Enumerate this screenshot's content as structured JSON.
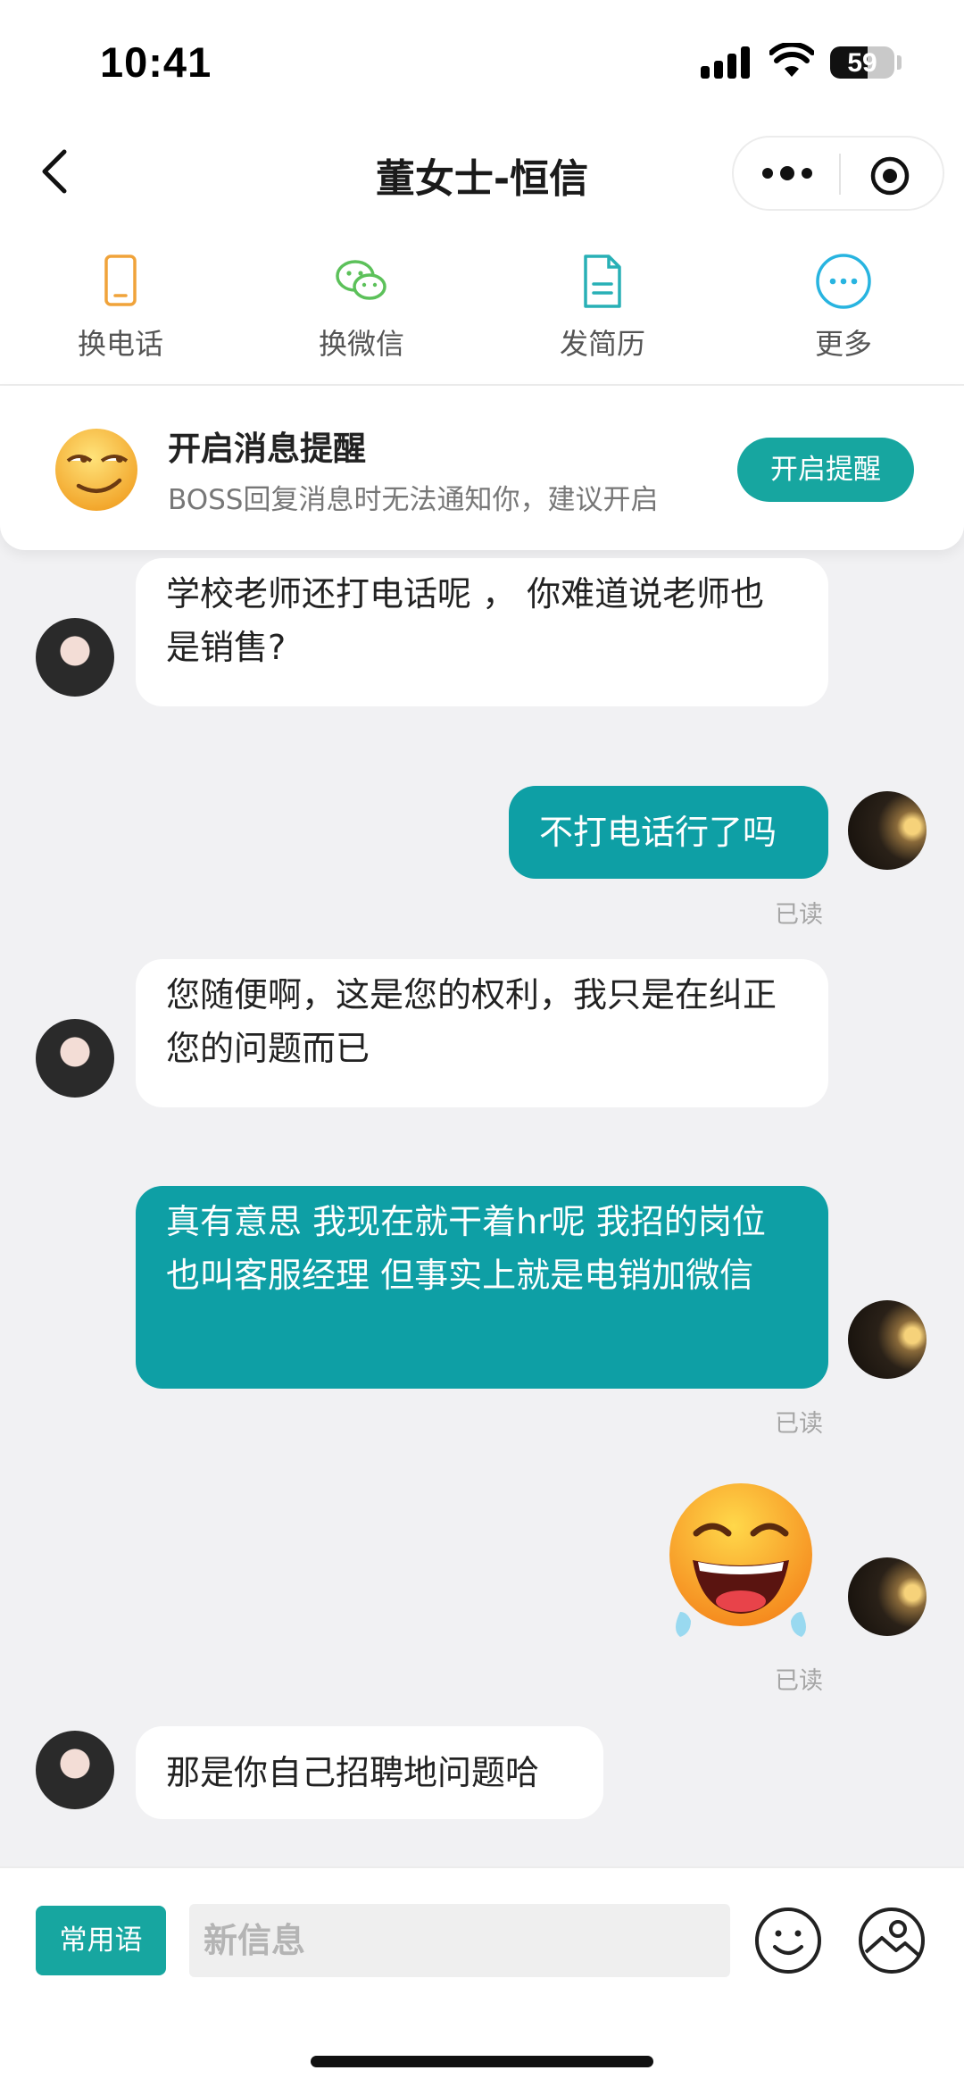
{
  "status_bar": {
    "time": "10:41",
    "battery": "59"
  },
  "header": {
    "title": "董女士-恒信"
  },
  "actions": [
    {
      "label": "换电话",
      "icon": "phone-icon"
    },
    {
      "label": "换微信",
      "icon": "wechat-icon"
    },
    {
      "label": "发简历",
      "icon": "resume-icon"
    },
    {
      "label": "更多",
      "icon": "more-icon"
    }
  ],
  "notification": {
    "title": "开启消息提醒",
    "description": "BOSS回复消息时无法通知你，建议开启",
    "button": "开启提醒"
  },
  "messages": [
    {
      "from": "other",
      "text": "学校老师还打电话呢 ， 你难道说老师也是销售?"
    },
    {
      "from": "self",
      "text": "不打电话行了吗",
      "status": "已读"
    },
    {
      "from": "other",
      "text": "您随便啊，这是您的权利，我只是在纠正您的问题而已"
    },
    {
      "from": "self",
      "text": "真有意思 我现在就干着hr呢 我招的岗位也叫客服经理 但事实上就是电销加微信",
      "status": "已读"
    },
    {
      "from": "self",
      "emoji": "laughing-tears-emoji",
      "status": "已读"
    },
    {
      "from": "other",
      "text": "那是你自己招聘地问题哈"
    }
  ],
  "input_bar": {
    "phrases_button": "常用语",
    "placeholder": "新信息"
  },
  "colors": {
    "accent": "#17a6a0",
    "bubble_out": "#0e9fa5"
  }
}
